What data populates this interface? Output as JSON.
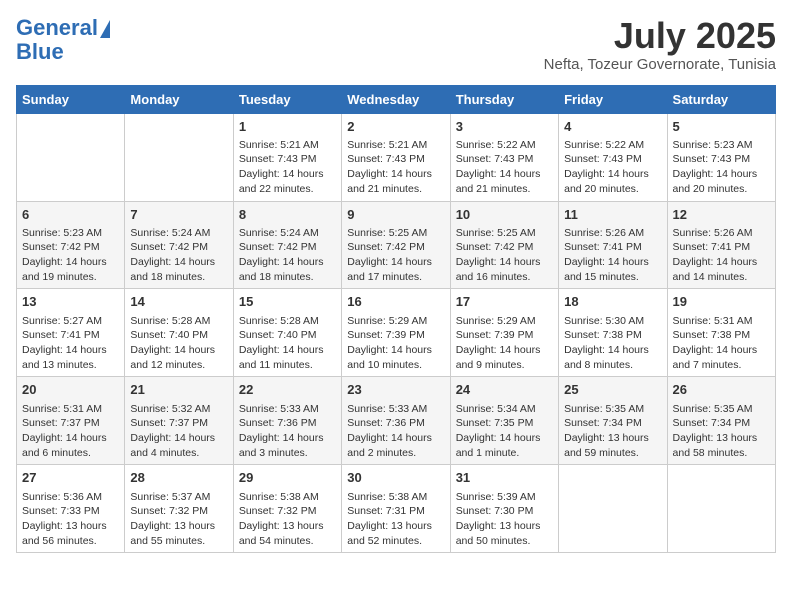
{
  "logo": {
    "line1": "General",
    "line2": "Blue"
  },
  "title": "July 2025",
  "subtitle": "Nefta, Tozeur Governorate, Tunisia",
  "headers": [
    "Sunday",
    "Monday",
    "Tuesday",
    "Wednesday",
    "Thursday",
    "Friday",
    "Saturday"
  ],
  "weeks": [
    [
      {
        "day": "",
        "content": ""
      },
      {
        "day": "",
        "content": ""
      },
      {
        "day": "1",
        "content": "Sunrise: 5:21 AM\nSunset: 7:43 PM\nDaylight: 14 hours and 22 minutes."
      },
      {
        "day": "2",
        "content": "Sunrise: 5:21 AM\nSunset: 7:43 PM\nDaylight: 14 hours and 21 minutes."
      },
      {
        "day": "3",
        "content": "Sunrise: 5:22 AM\nSunset: 7:43 PM\nDaylight: 14 hours and 21 minutes."
      },
      {
        "day": "4",
        "content": "Sunrise: 5:22 AM\nSunset: 7:43 PM\nDaylight: 14 hours and 20 minutes."
      },
      {
        "day": "5",
        "content": "Sunrise: 5:23 AM\nSunset: 7:43 PM\nDaylight: 14 hours and 20 minutes."
      }
    ],
    [
      {
        "day": "6",
        "content": "Sunrise: 5:23 AM\nSunset: 7:42 PM\nDaylight: 14 hours and 19 minutes."
      },
      {
        "day": "7",
        "content": "Sunrise: 5:24 AM\nSunset: 7:42 PM\nDaylight: 14 hours and 18 minutes."
      },
      {
        "day": "8",
        "content": "Sunrise: 5:24 AM\nSunset: 7:42 PM\nDaylight: 14 hours and 18 minutes."
      },
      {
        "day": "9",
        "content": "Sunrise: 5:25 AM\nSunset: 7:42 PM\nDaylight: 14 hours and 17 minutes."
      },
      {
        "day": "10",
        "content": "Sunrise: 5:25 AM\nSunset: 7:42 PM\nDaylight: 14 hours and 16 minutes."
      },
      {
        "day": "11",
        "content": "Sunrise: 5:26 AM\nSunset: 7:41 PM\nDaylight: 14 hours and 15 minutes."
      },
      {
        "day": "12",
        "content": "Sunrise: 5:26 AM\nSunset: 7:41 PM\nDaylight: 14 hours and 14 minutes."
      }
    ],
    [
      {
        "day": "13",
        "content": "Sunrise: 5:27 AM\nSunset: 7:41 PM\nDaylight: 14 hours and 13 minutes."
      },
      {
        "day": "14",
        "content": "Sunrise: 5:28 AM\nSunset: 7:40 PM\nDaylight: 14 hours and 12 minutes."
      },
      {
        "day": "15",
        "content": "Sunrise: 5:28 AM\nSunset: 7:40 PM\nDaylight: 14 hours and 11 minutes."
      },
      {
        "day": "16",
        "content": "Sunrise: 5:29 AM\nSunset: 7:39 PM\nDaylight: 14 hours and 10 minutes."
      },
      {
        "day": "17",
        "content": "Sunrise: 5:29 AM\nSunset: 7:39 PM\nDaylight: 14 hours and 9 minutes."
      },
      {
        "day": "18",
        "content": "Sunrise: 5:30 AM\nSunset: 7:38 PM\nDaylight: 14 hours and 8 minutes."
      },
      {
        "day": "19",
        "content": "Sunrise: 5:31 AM\nSunset: 7:38 PM\nDaylight: 14 hours and 7 minutes."
      }
    ],
    [
      {
        "day": "20",
        "content": "Sunrise: 5:31 AM\nSunset: 7:37 PM\nDaylight: 14 hours and 6 minutes."
      },
      {
        "day": "21",
        "content": "Sunrise: 5:32 AM\nSunset: 7:37 PM\nDaylight: 14 hours and 4 minutes."
      },
      {
        "day": "22",
        "content": "Sunrise: 5:33 AM\nSunset: 7:36 PM\nDaylight: 14 hours and 3 minutes."
      },
      {
        "day": "23",
        "content": "Sunrise: 5:33 AM\nSunset: 7:36 PM\nDaylight: 14 hours and 2 minutes."
      },
      {
        "day": "24",
        "content": "Sunrise: 5:34 AM\nSunset: 7:35 PM\nDaylight: 14 hours and 1 minute."
      },
      {
        "day": "25",
        "content": "Sunrise: 5:35 AM\nSunset: 7:34 PM\nDaylight: 13 hours and 59 minutes."
      },
      {
        "day": "26",
        "content": "Sunrise: 5:35 AM\nSunset: 7:34 PM\nDaylight: 13 hours and 58 minutes."
      }
    ],
    [
      {
        "day": "27",
        "content": "Sunrise: 5:36 AM\nSunset: 7:33 PM\nDaylight: 13 hours and 56 minutes."
      },
      {
        "day": "28",
        "content": "Sunrise: 5:37 AM\nSunset: 7:32 PM\nDaylight: 13 hours and 55 minutes."
      },
      {
        "day": "29",
        "content": "Sunrise: 5:38 AM\nSunset: 7:32 PM\nDaylight: 13 hours and 54 minutes."
      },
      {
        "day": "30",
        "content": "Sunrise: 5:38 AM\nSunset: 7:31 PM\nDaylight: 13 hours and 52 minutes."
      },
      {
        "day": "31",
        "content": "Sunrise: 5:39 AM\nSunset: 7:30 PM\nDaylight: 13 hours and 50 minutes."
      },
      {
        "day": "",
        "content": ""
      },
      {
        "day": "",
        "content": ""
      }
    ]
  ]
}
